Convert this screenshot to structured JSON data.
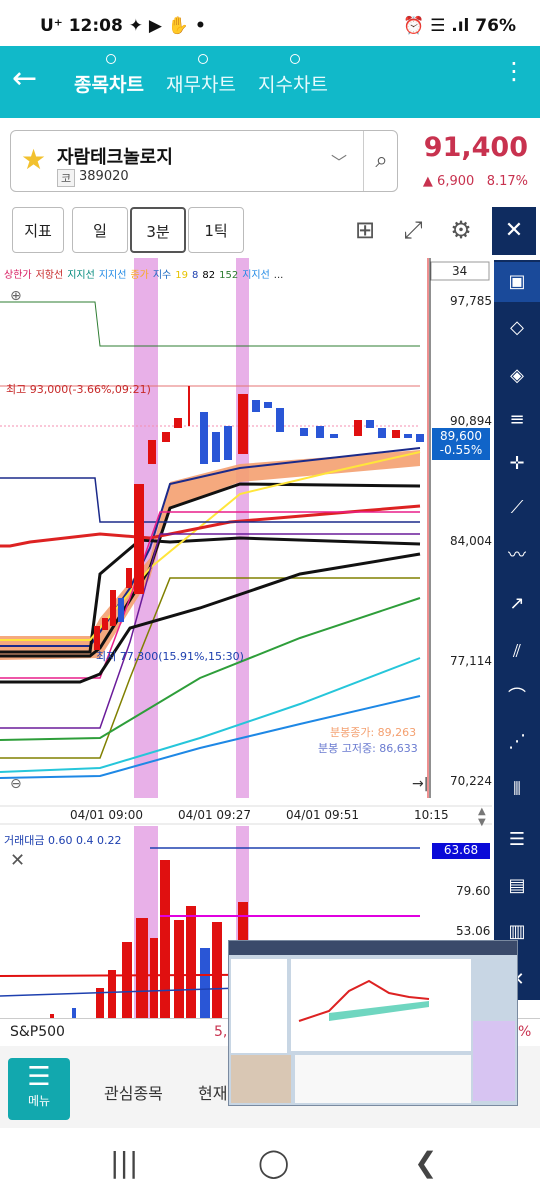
{
  "statusbar": {
    "left": "U⁺ 12:08 ✦ ▶ ✋ •",
    "right": "⏰ ☰ .ıl 76%"
  },
  "appbar": {
    "tabs": [
      "종목차트",
      "재무차트",
      "지수차트"
    ],
    "active_tab": 0
  },
  "stock": {
    "name": "자람테크놀로지",
    "badge": "코",
    "code": "389020",
    "price": "91,400",
    "change": "▲ 6,900",
    "change_pct": "8.17%"
  },
  "toolbar": {
    "indicator": "지표",
    "period_day": "일",
    "period_min": "3분",
    "period_tick": "1틱"
  },
  "chart": {
    "legend": [
      {
        "text": "상한가",
        "color": "#d81b60"
      },
      {
        "text": "저항선",
        "color": "#c62828"
      },
      {
        "text": "지지선",
        "color": "#00897b"
      },
      {
        "text": "지지선",
        "color": "#1e88e5"
      },
      {
        "text": "종가",
        "color": "#f9a825"
      },
      {
        "text": "지수",
        "color": "#1565c0"
      },
      {
        "text": "19",
        "color": "#e6c200"
      },
      {
        "text": "8",
        "color": "#1e40af"
      },
      {
        "text": "82",
        "color": "#000"
      },
      {
        "text": "152",
        "color": "#2e7d32"
      },
      {
        "text": "지지선",
        "color": "#1e88e5"
      },
      {
        "text": "...",
        "color": "#222"
      }
    ],
    "top_axis_value": "34",
    "y_labels": [
      "97,785",
      "90,894",
      "84,004",
      "77,114",
      "70,224"
    ],
    "current_price": "89,600",
    "current_change": "-0.55%",
    "high_note": "최고 93,000(-3.66%,09:21)",
    "low_note": "최저 77,300(15.91%,15:30)",
    "split_close": "분봉종가: 89,263",
    "split_high": "분봉 고저중: 86,633",
    "x_labels": [
      "04/01 09:00",
      "04/01 09:27",
      "04/01 09:51",
      "10:15"
    ]
  },
  "volume": {
    "legend": "거래대금 0.60 0.4 0.22",
    "current": "63.68",
    "y_labels": [
      "79.60",
      "53.06"
    ]
  },
  "index_bar": {
    "name": "S&P500",
    "value": "5,",
    "pct": "%"
  },
  "bottomnav": {
    "menu": "메뉴",
    "items": [
      "관심종목",
      "현재"
    ]
  },
  "colors": {
    "accent": "#11b9c9",
    "up": "#c8324f",
    "down": "#1064c8",
    "sidebar": "#0f2c60",
    "highlight": "#e8b0e8"
  }
}
